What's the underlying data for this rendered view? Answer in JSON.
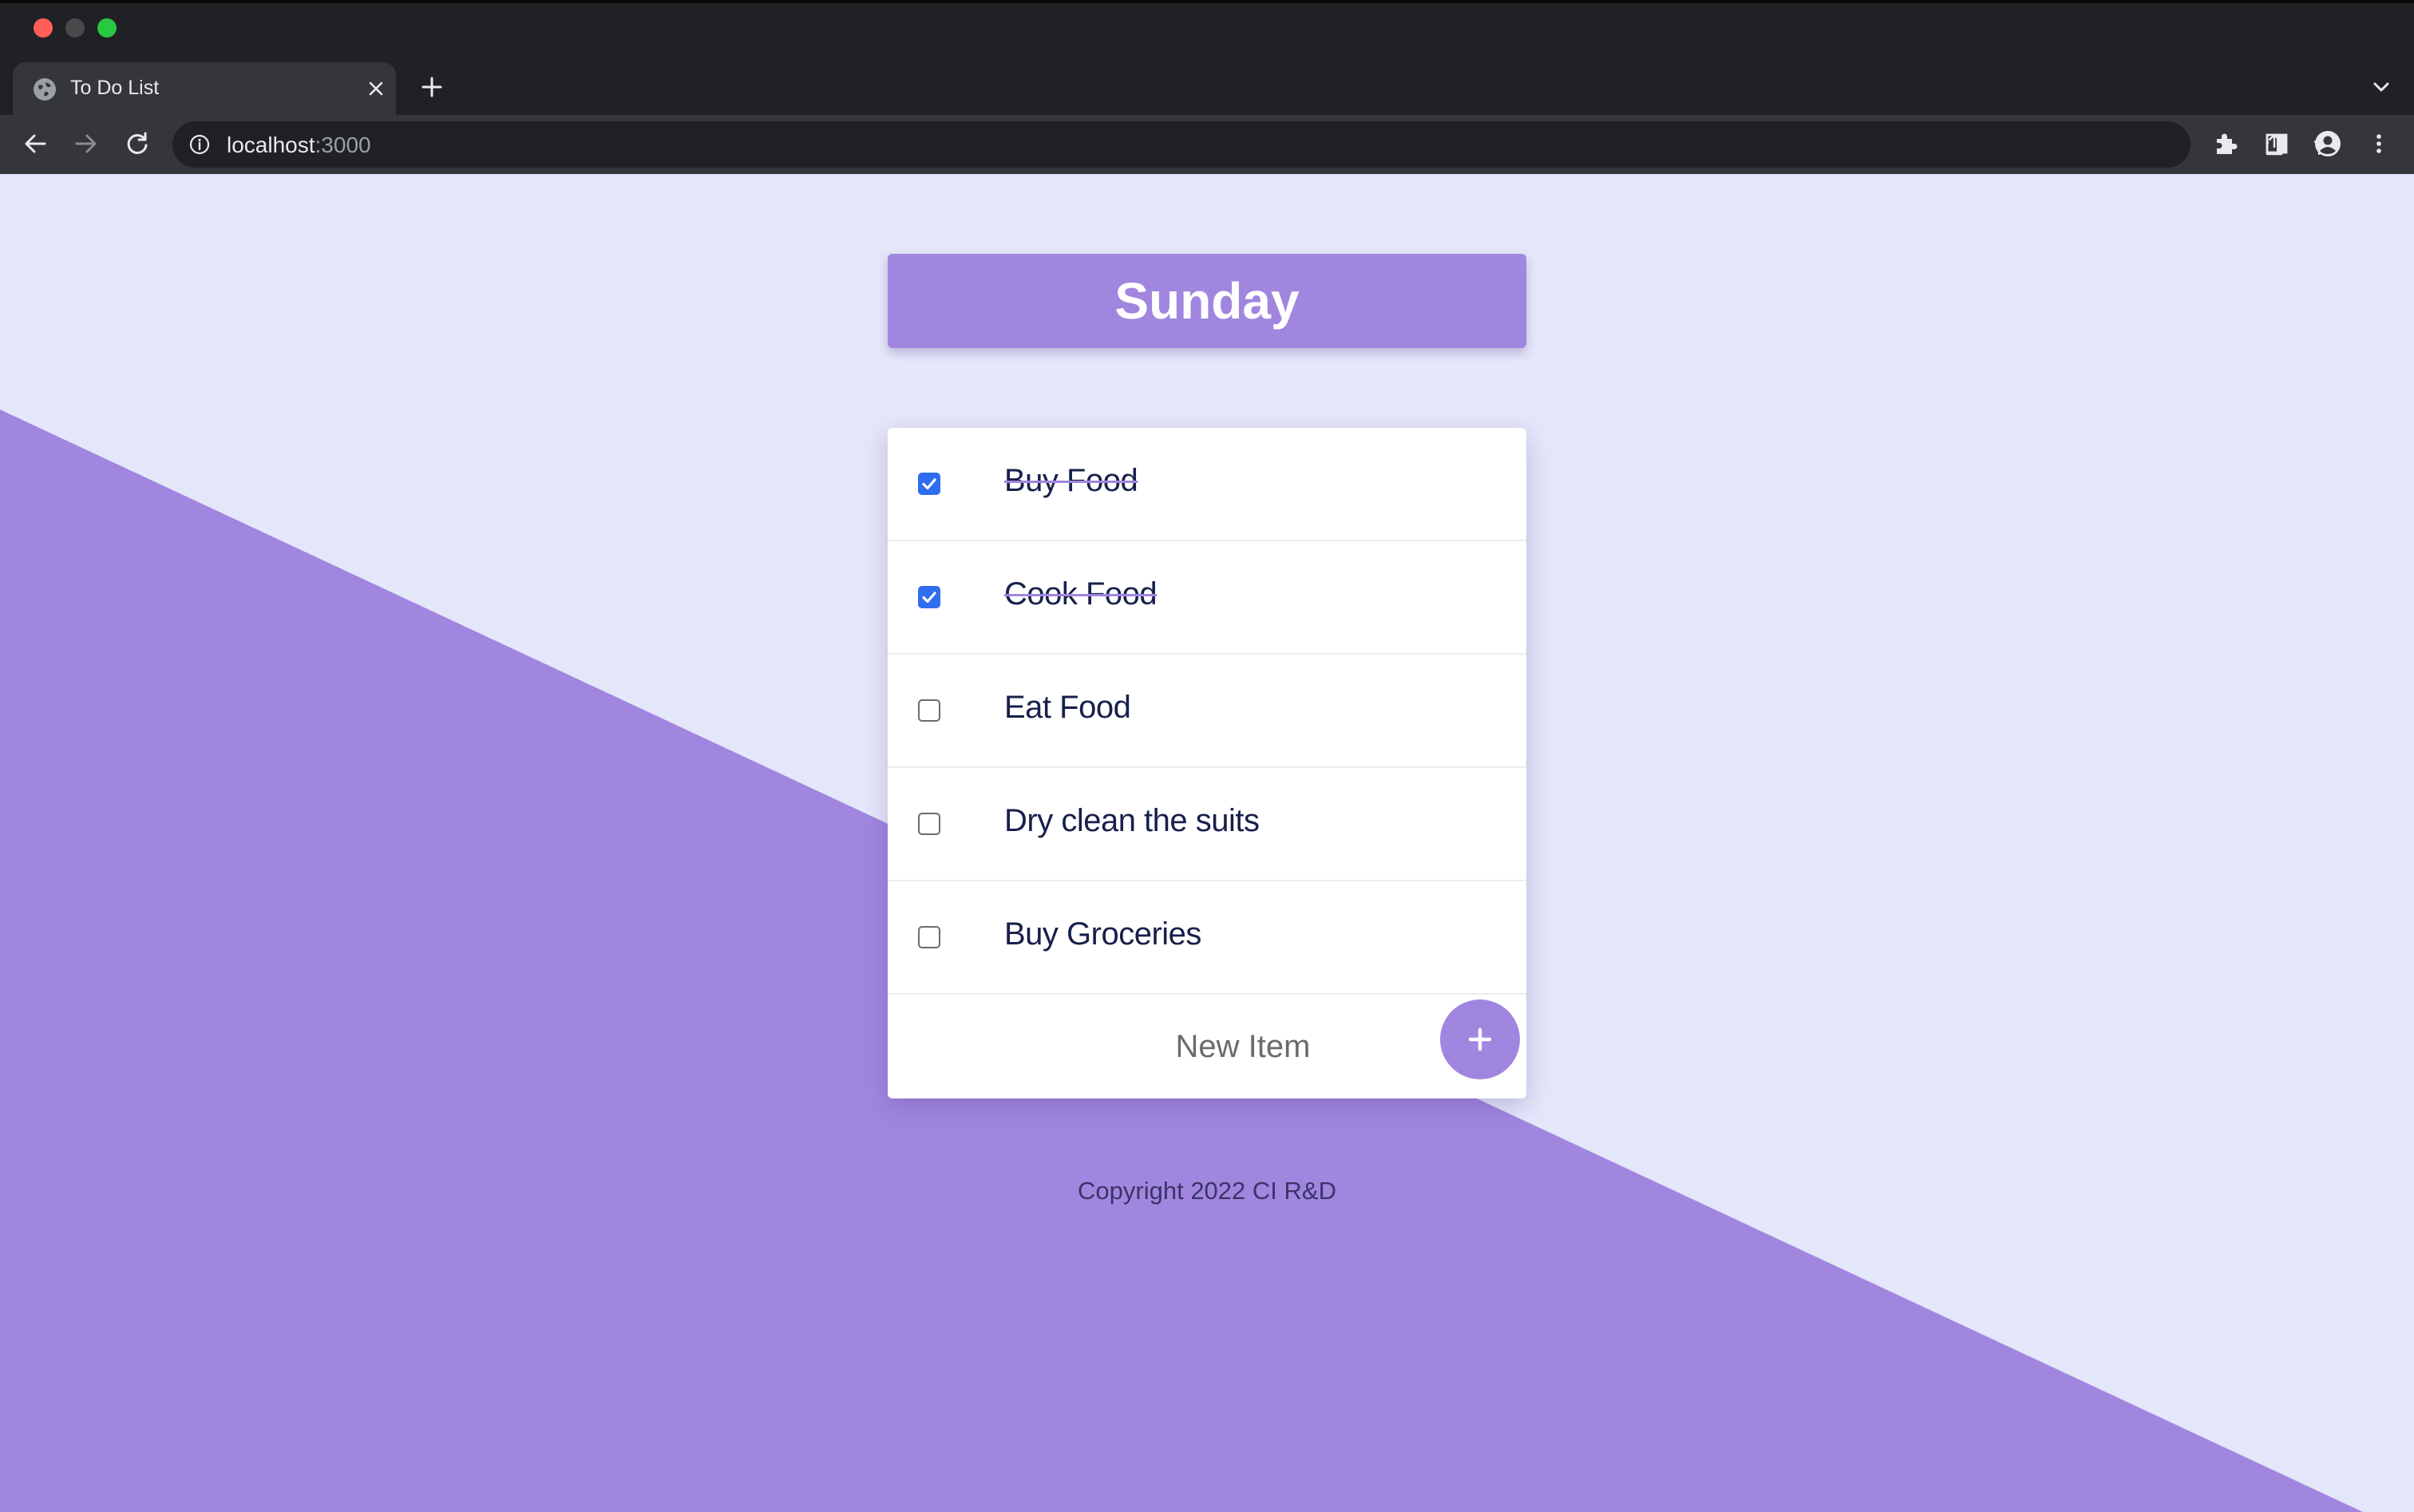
{
  "browser": {
    "tab_title": "To Do List",
    "url_host": "localhost",
    "url_port": ":3000"
  },
  "colors": {
    "accent": "#a186df",
    "page_background": "#e4e6fa",
    "checkbox_checked": "#2f6df0",
    "text_dark": "#17204b"
  },
  "todo": {
    "heading": "Sunday",
    "items": [
      {
        "label": "Buy Food",
        "checked": true
      },
      {
        "label": "Cook Food",
        "checked": true
      },
      {
        "label": "Eat Food",
        "checked": false
      },
      {
        "label": "Dry clean the suits",
        "checked": false
      },
      {
        "label": "Buy Groceries",
        "checked": false
      }
    ],
    "new_item_placeholder": "New Item",
    "add_button_symbol": "+"
  },
  "footer": {
    "text": "Copyright 2022 CI R&D"
  }
}
